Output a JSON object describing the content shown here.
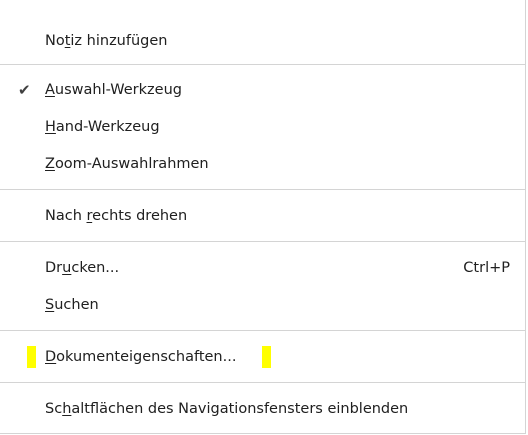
{
  "menu": {
    "items": [
      {
        "pre": "No",
        "mnemonic": "t",
        "post": "iz hinzufügen",
        "shortcut": "",
        "checked": false
      },
      {
        "pre": "",
        "mnemonic": "A",
        "post": "uswahl-Werkzeug",
        "shortcut": "",
        "checked": true
      },
      {
        "pre": "",
        "mnemonic": "H",
        "post": "and-Werkzeug",
        "shortcut": "",
        "checked": false
      },
      {
        "pre": "",
        "mnemonic": "Z",
        "post": "oom-Auswahlrahmen",
        "shortcut": "",
        "checked": false
      },
      {
        "pre": "Nach ",
        "mnemonic": "r",
        "post": "echts drehen",
        "shortcut": "",
        "checked": false
      },
      {
        "pre": "Dr",
        "mnemonic": "u",
        "post": "cken...",
        "shortcut": "Ctrl+P",
        "checked": false
      },
      {
        "pre": "",
        "mnemonic": "S",
        "post": "uchen",
        "shortcut": "",
        "checked": false
      },
      {
        "pre": "",
        "mnemonic": "D",
        "post": "okumenteigenschaften...",
        "shortcut": "",
        "checked": false
      },
      {
        "pre": "Sc",
        "mnemonic": "h",
        "post": "altflächen des Navigationsfensters einblenden",
        "shortcut": "",
        "checked": false
      }
    ],
    "check_glyph": "✔",
    "highlight_color": "#ffff00"
  }
}
